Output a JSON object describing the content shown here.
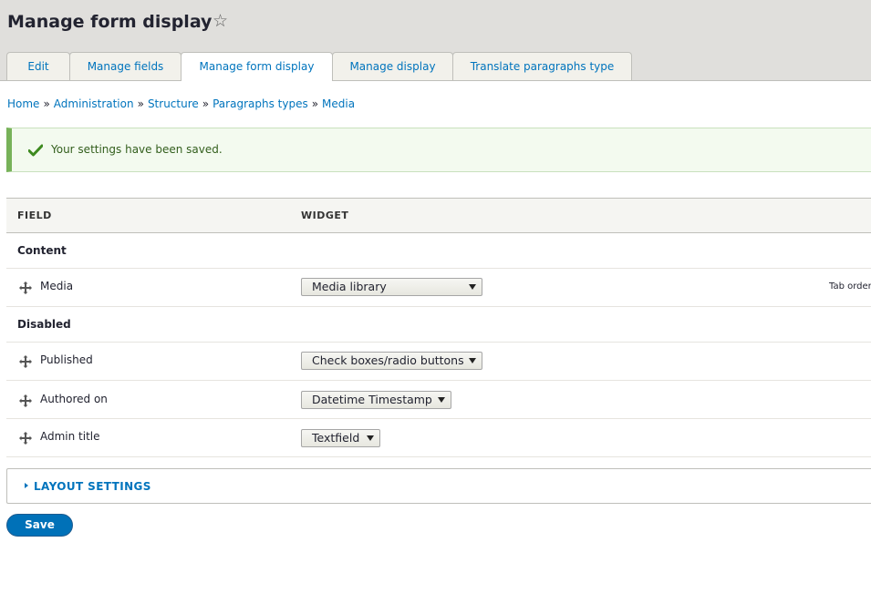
{
  "page": {
    "title": "Manage form display"
  },
  "tabs": [
    {
      "label": "Edit"
    },
    {
      "label": "Manage fields"
    },
    {
      "label": "Manage form display"
    },
    {
      "label": "Manage display"
    },
    {
      "label": "Translate paragraphs type"
    }
  ],
  "breadcrumb": [
    "Home",
    "Administration",
    "Structure",
    "Paragraphs types",
    "Media"
  ],
  "breadcrumb_separator": "»",
  "message": {
    "text": "Your settings have been saved.",
    "color": "#77b259"
  },
  "table": {
    "headers": {
      "field": "FIELD",
      "widget": "WIDGET"
    },
    "regions": [
      {
        "title": "Content",
        "rows": [
          {
            "field": "Media",
            "widget": "Media library"
          }
        ]
      },
      {
        "title": "Disabled",
        "rows": [
          {
            "field": "Published",
            "widget": "Check boxes/radio buttons"
          },
          {
            "field": "Authored on",
            "widget": "Datetime Timestamp"
          },
          {
            "field": "Admin title",
            "widget": "Textfield"
          }
        ]
      }
    ],
    "tab_order": "Tab order"
  },
  "layout_settings": {
    "label": "LAYOUT SETTINGS"
  },
  "actions": {
    "save_label": "Save"
  },
  "colors": {
    "accent": "#0074bd",
    "button": "#0071b8"
  },
  "icons": {
    "star": "star-icon",
    "drag": "drag-handle-icon",
    "check": "check-icon"
  }
}
